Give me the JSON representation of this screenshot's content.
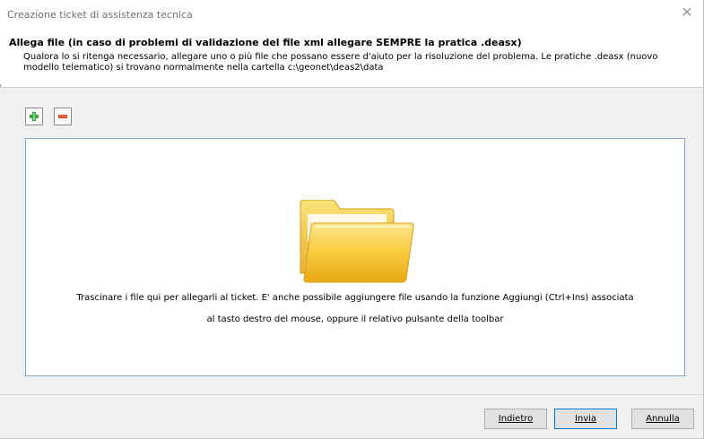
{
  "window": {
    "title": "Creazione ticket di assistenza tecnica"
  },
  "header": {
    "title": "Allega file (in caso di problemi di validazione del file xml allegare SEMPRE la pratica .deasx)",
    "description": "Qualora lo si ritenga necessario, allegare uno o più file che possano essere d'aiuto per la risoluzione del problema. Le pratiche .deasx (nuovo modello telematico) si trovano normalmente nella cartella c:\\geonet\\deas2\\data"
  },
  "toolbar": {
    "add_icon": "plus-icon",
    "remove_icon": "minus-icon",
    "add_color": "#3aa63a",
    "remove_color": "#e04a2a"
  },
  "drop_area": {
    "icon": "folder-icon",
    "line1": "Trascinare i file qui per allegarli al ticket.  E' anche possibile aggiungere file usando la funzione Aggiungi (Ctrl+Ins) associata",
    "line2": "al tasto destro del mouse, oppure il relativo pulsante della toolbar"
  },
  "buttons": {
    "back": "Indietro",
    "send": "Invia",
    "cancel": "Annulla"
  },
  "colors": {
    "accent": "#0078d7",
    "drop_border": "#7aa7d4",
    "folder": "#f6c94a"
  }
}
